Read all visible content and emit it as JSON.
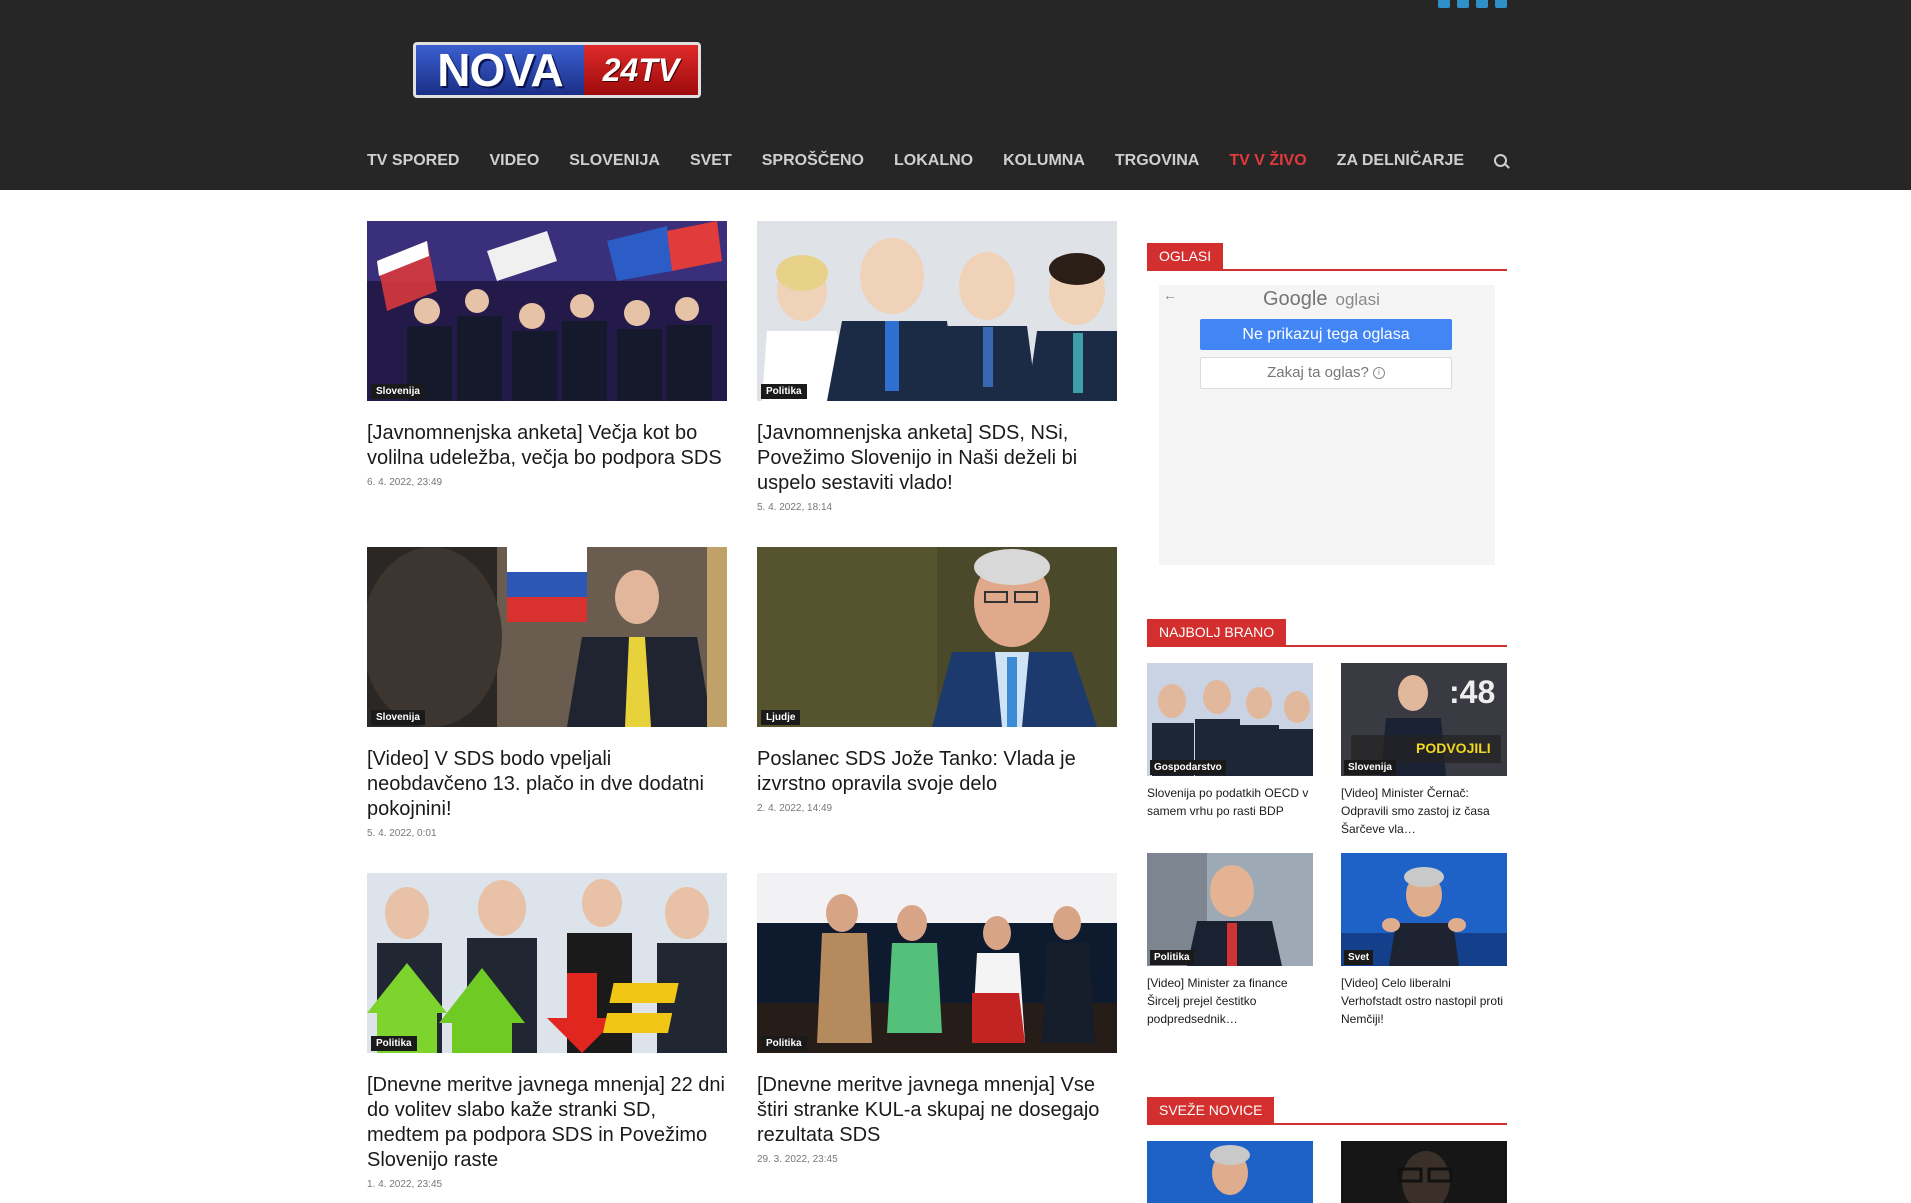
{
  "header": {
    "logo_main": "NOVA",
    "logo_tag": "24TV",
    "social_icons": [
      "facebook-icon",
      "rss-icon",
      "twitter-icon",
      "youtube-icon"
    ]
  },
  "nav": {
    "items": [
      "TV SPORED",
      "VIDEO",
      "SLOVENIJA",
      "SVET",
      "SPROŠČENO",
      "LOKALNO",
      "KOLUMNA",
      "TRGOVINA",
      "TV V ŽIVO",
      "ZA DELNIČARJE"
    ],
    "live_color": "#e03a3e"
  },
  "articles": [
    {
      "category": "Slovenija",
      "title": "[Javnomnenjska anketa] Večja kot bo volilna udeležba, večja bo podpora SDS",
      "date": "6. 4. 2022, 23:49"
    },
    {
      "category": "Politika",
      "title": "[Javnomnenjska anketa] SDS, NSi, Povežimo Slovenijo in Naši deželi bi uspelo sestaviti vlado!",
      "date": "5. 4. 2022, 18:14"
    },
    {
      "category": "Slovenija",
      "title": "[Video] V SDS bodo vpeljali neobdavčeno 13. plačo in dve dodatni pokojnini!",
      "date": "5. 4. 2022, 0:01"
    },
    {
      "category": "Ljudje",
      "title": "Poslanec SDS Jože Tanko: Vlada je izvrstno opravila svoje delo",
      "date": "2. 4. 2022, 14:49"
    },
    {
      "category": "Politika",
      "title": "[Dnevne meritve javnega mnenja] 22 dni do volitev slabo kaže stranki SD, medtem pa podpora SDS in Povežimo Slovenijo raste",
      "date": "1. 4. 2022, 23:45"
    },
    {
      "category": "Politika",
      "title": "[Dnevne meritve javnega mnenja] Vse štiri stranke KUL-a skupaj ne dosegajo rezultata SDS",
      "date": "29. 3. 2022, 23:45"
    }
  ],
  "sidebar": {
    "ads_title": "OGLASI",
    "ad": {
      "back": "←",
      "google": "Google",
      "oglasi": "oglasi",
      "hide_button": "Ne prikazuj tega oglasa",
      "why_button": "Zakaj ta oglas?",
      "info": "i"
    },
    "most_read_title": "NAJBOLJ BRANO",
    "most_read": [
      {
        "category": "Gospodarstvo",
        "title": "Slovenija po podatkih OECD v samem vrhu po rasti BDP"
      },
      {
        "category": "Slovenija",
        "title": "[Video] Minister Černač: Odpravili smo zastoj iz časa Šarčeve vla…",
        "thumb_text": ":48",
        "thumb_caption": "PODVOJILI"
      },
      {
        "category": "Politika",
        "title": "[Video] Minister za finance Šircelj prejel čestitko podpredsednik…"
      },
      {
        "category": "Svet",
        "title": "[Video] Celo liberalni Verhofstadt ostro nastopil proti Nemčiji!"
      }
    ],
    "fresh_title": "SVEŽE NOVICE"
  },
  "colors": {
    "header_bg": "#262626",
    "accent_red": "#d32f2f",
    "ad_blue": "#4285f4"
  }
}
